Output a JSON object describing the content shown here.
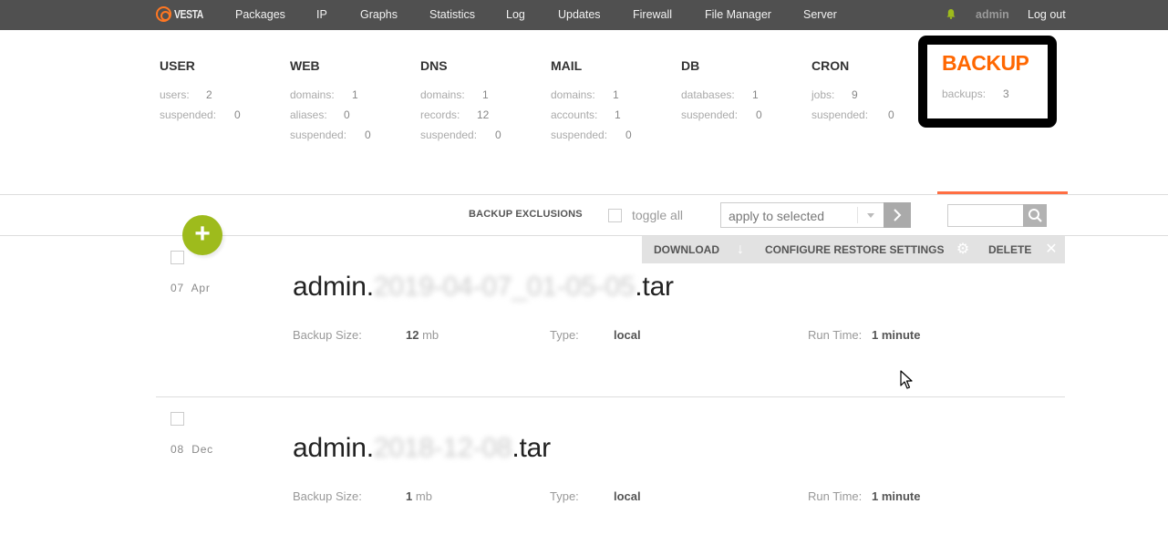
{
  "nav": {
    "logo": "VESTA",
    "items": [
      "Packages",
      "IP",
      "Graphs",
      "Statistics",
      "Log",
      "Updates",
      "Firewall",
      "File Manager",
      "Server"
    ],
    "user": "admin",
    "logout": "Log out"
  },
  "stats": [
    {
      "title": "USER",
      "rows": [
        {
          "label": "users:",
          "value": "2"
        },
        {
          "label": "suspended:",
          "value": "0"
        }
      ]
    },
    {
      "title": "WEB",
      "rows": [
        {
          "label": "domains:",
          "value": "1"
        },
        {
          "label": "aliases:",
          "value": "0"
        },
        {
          "label": "suspended:",
          "value": "0"
        }
      ]
    },
    {
      "title": "DNS",
      "rows": [
        {
          "label": "domains:",
          "value": "1"
        },
        {
          "label": "records:",
          "value": "12"
        },
        {
          "label": "suspended:",
          "value": "0"
        }
      ]
    },
    {
      "title": "MAIL",
      "rows": [
        {
          "label": "domains:",
          "value": "1"
        },
        {
          "label": "accounts:",
          "value": "1"
        },
        {
          "label": "suspended:",
          "value": "0"
        }
      ]
    },
    {
      "title": "DB",
      "rows": [
        {
          "label": "databases:",
          "value": "1"
        },
        {
          "label": "suspended:",
          "value": "0"
        }
      ]
    },
    {
      "title": "CRON",
      "rows": [
        {
          "label": "jobs:",
          "value": "9"
        },
        {
          "label": "suspended:",
          "value": "0"
        }
      ]
    }
  ],
  "backup_tab": {
    "title": "BACKUP",
    "label": "backups:",
    "value": "3"
  },
  "toolbar": {
    "add_icon": "+",
    "exclusions": "BACKUP EXCLUSIONS",
    "toggle_all": "toggle all",
    "action_select": "apply to selected"
  },
  "actions": {
    "download": "DOWNLOAD",
    "configure": "CONFIGURE RESTORE SETTINGS",
    "delete": "DELETE"
  },
  "backups": [
    {
      "day": "07",
      "month": "Apr",
      "name_prefix": "admin.",
      "name_hidden": "2019-04-07_01-05-05",
      "name_suffix": ".tar",
      "size_label": "Backup Size:",
      "size_value": "12",
      "size_unit": "mb",
      "type_label": "Type:",
      "type_value": "local",
      "runtime_label": "Run Time:",
      "runtime_value": "1 minute"
    },
    {
      "day": "08",
      "month": "Dec",
      "name_prefix": "admin.",
      "name_hidden": "2018-12-08",
      "name_suffix": ".tar",
      "size_label": "Backup Size:",
      "size_value": "1",
      "size_unit": "mb",
      "type_label": "Type:",
      "type_value": "local",
      "runtime_label": "Run Time:",
      "runtime_value": "1 minute"
    }
  ],
  "colors": {
    "accent": "#ff6701",
    "add_button": "#9ebb1c",
    "topbar": "#505050"
  }
}
